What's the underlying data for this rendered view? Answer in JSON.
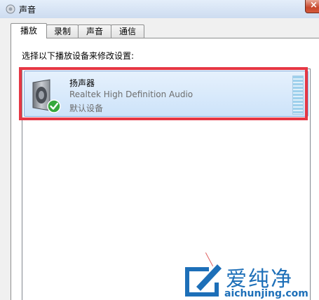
{
  "window": {
    "title": "声音",
    "close_label": "×"
  },
  "tabs": [
    {
      "label": "播放"
    },
    {
      "label": "录制"
    },
    {
      "label": "声音"
    },
    {
      "label": "通信"
    }
  ],
  "playback": {
    "instruction": "选择以下播放设备来修改设置:",
    "devices": [
      {
        "name": "扬声器",
        "description": "Realtek High Definition Audio",
        "status": "默认设备"
      }
    ]
  },
  "watermark": {
    "brand": "爱纯净",
    "url": "aichunjing.com"
  },
  "colors": {
    "highlight": "#e63744",
    "selection": "#cde3fa",
    "watermark": "#1d6fb8"
  }
}
